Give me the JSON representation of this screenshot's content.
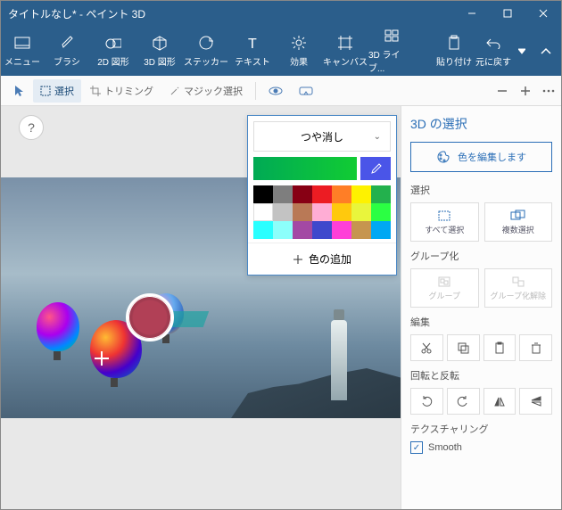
{
  "titlebar": {
    "title": "タイトルなし* - ペイント 3D"
  },
  "ribbon": {
    "menu": "メニュー",
    "items": [
      {
        "id": "brush",
        "label": "ブラシ"
      },
      {
        "id": "shape2d",
        "label": "2D 図形"
      },
      {
        "id": "shape3d",
        "label": "3D 図形"
      },
      {
        "id": "sticker",
        "label": "ステッカー"
      },
      {
        "id": "text",
        "label": "テキスト"
      },
      {
        "id": "effect",
        "label": "効果"
      },
      {
        "id": "canvas",
        "label": "キャンバス"
      },
      {
        "id": "lib3d",
        "label": "3D ライブ..."
      }
    ],
    "tail": [
      {
        "id": "paste",
        "label": "貼り付け"
      },
      {
        "id": "undo",
        "label": "元に戻す"
      }
    ]
  },
  "toolbar": {
    "select": "選択",
    "trim": "トリミング",
    "magic": "マジック選択"
  },
  "popup": {
    "finish": "つや消し",
    "addcolor": "色の追加",
    "swatches": [
      "#000000",
      "#7e7e7e",
      "#870014",
      "#ec1c23",
      "#ff7e26",
      "#fef200",
      "#23b14d",
      "#ffffff",
      "#c3c3c3",
      "#b97956",
      "#ffadd5",
      "#ffc90d",
      "#a349a4",
      "#3f48cc",
      "#00a8f3",
      "#6ff2ff",
      "#9aff6b",
      "#ffb27f",
      "#c191cb",
      "#8cfffb",
      "#c6954f"
    ]
  },
  "side": {
    "title": "3D の選択",
    "editcolor": "色を編集します",
    "sec_select": "選択",
    "select_all": "すべて選択",
    "multi_select": "複数選択",
    "sec_group": "グループ化",
    "group": "グループ",
    "ungroup": "グループ化解除",
    "sec_edit": "編集",
    "sec_rotate": "回転と反転",
    "sec_texture": "テクスチャリング",
    "smooth": "Smooth"
  },
  "help": "?"
}
